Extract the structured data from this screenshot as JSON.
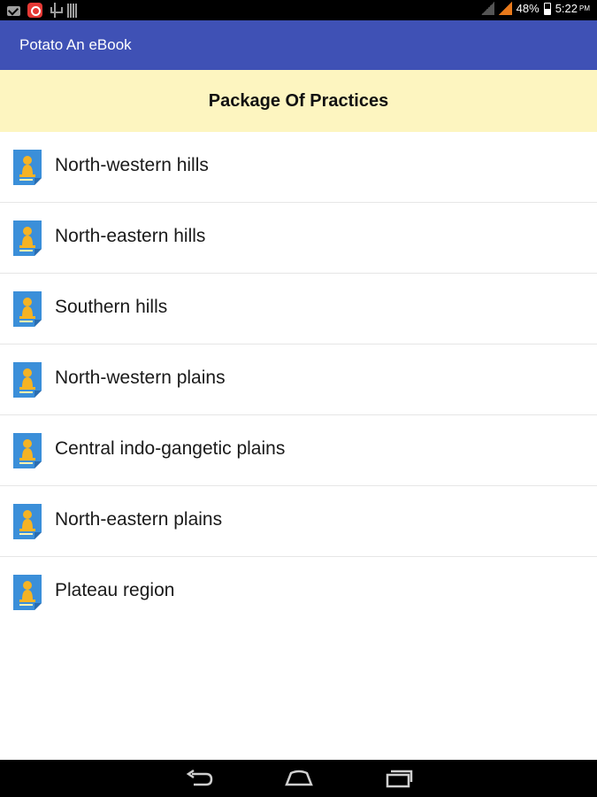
{
  "status_bar": {
    "battery": "48%",
    "time": "5:22",
    "ampm": "PM",
    "icons": [
      "email-icon",
      "app-notification-icon",
      "usb-icon",
      "storage-icon",
      "signal-icon",
      "signal-icon",
      "battery-icon"
    ]
  },
  "app_bar": {
    "title": "Potato An eBook",
    "color": "#3f51b5"
  },
  "section": {
    "title": "Package Of Practices",
    "color": "#fdf5c0"
  },
  "list": {
    "icon": "document-icon",
    "items": [
      {
        "label": "North-western hills"
      },
      {
        "label": "North-eastern hills"
      },
      {
        "label": "Southern hills"
      },
      {
        "label": "North-western plains"
      },
      {
        "label": "Central indo-gangetic plains"
      },
      {
        "label": "North-eastern plains"
      },
      {
        "label": "Plateau region"
      }
    ]
  },
  "nav_bar": {
    "icons": [
      "back-icon",
      "home-icon",
      "recent-apps-icon"
    ]
  }
}
